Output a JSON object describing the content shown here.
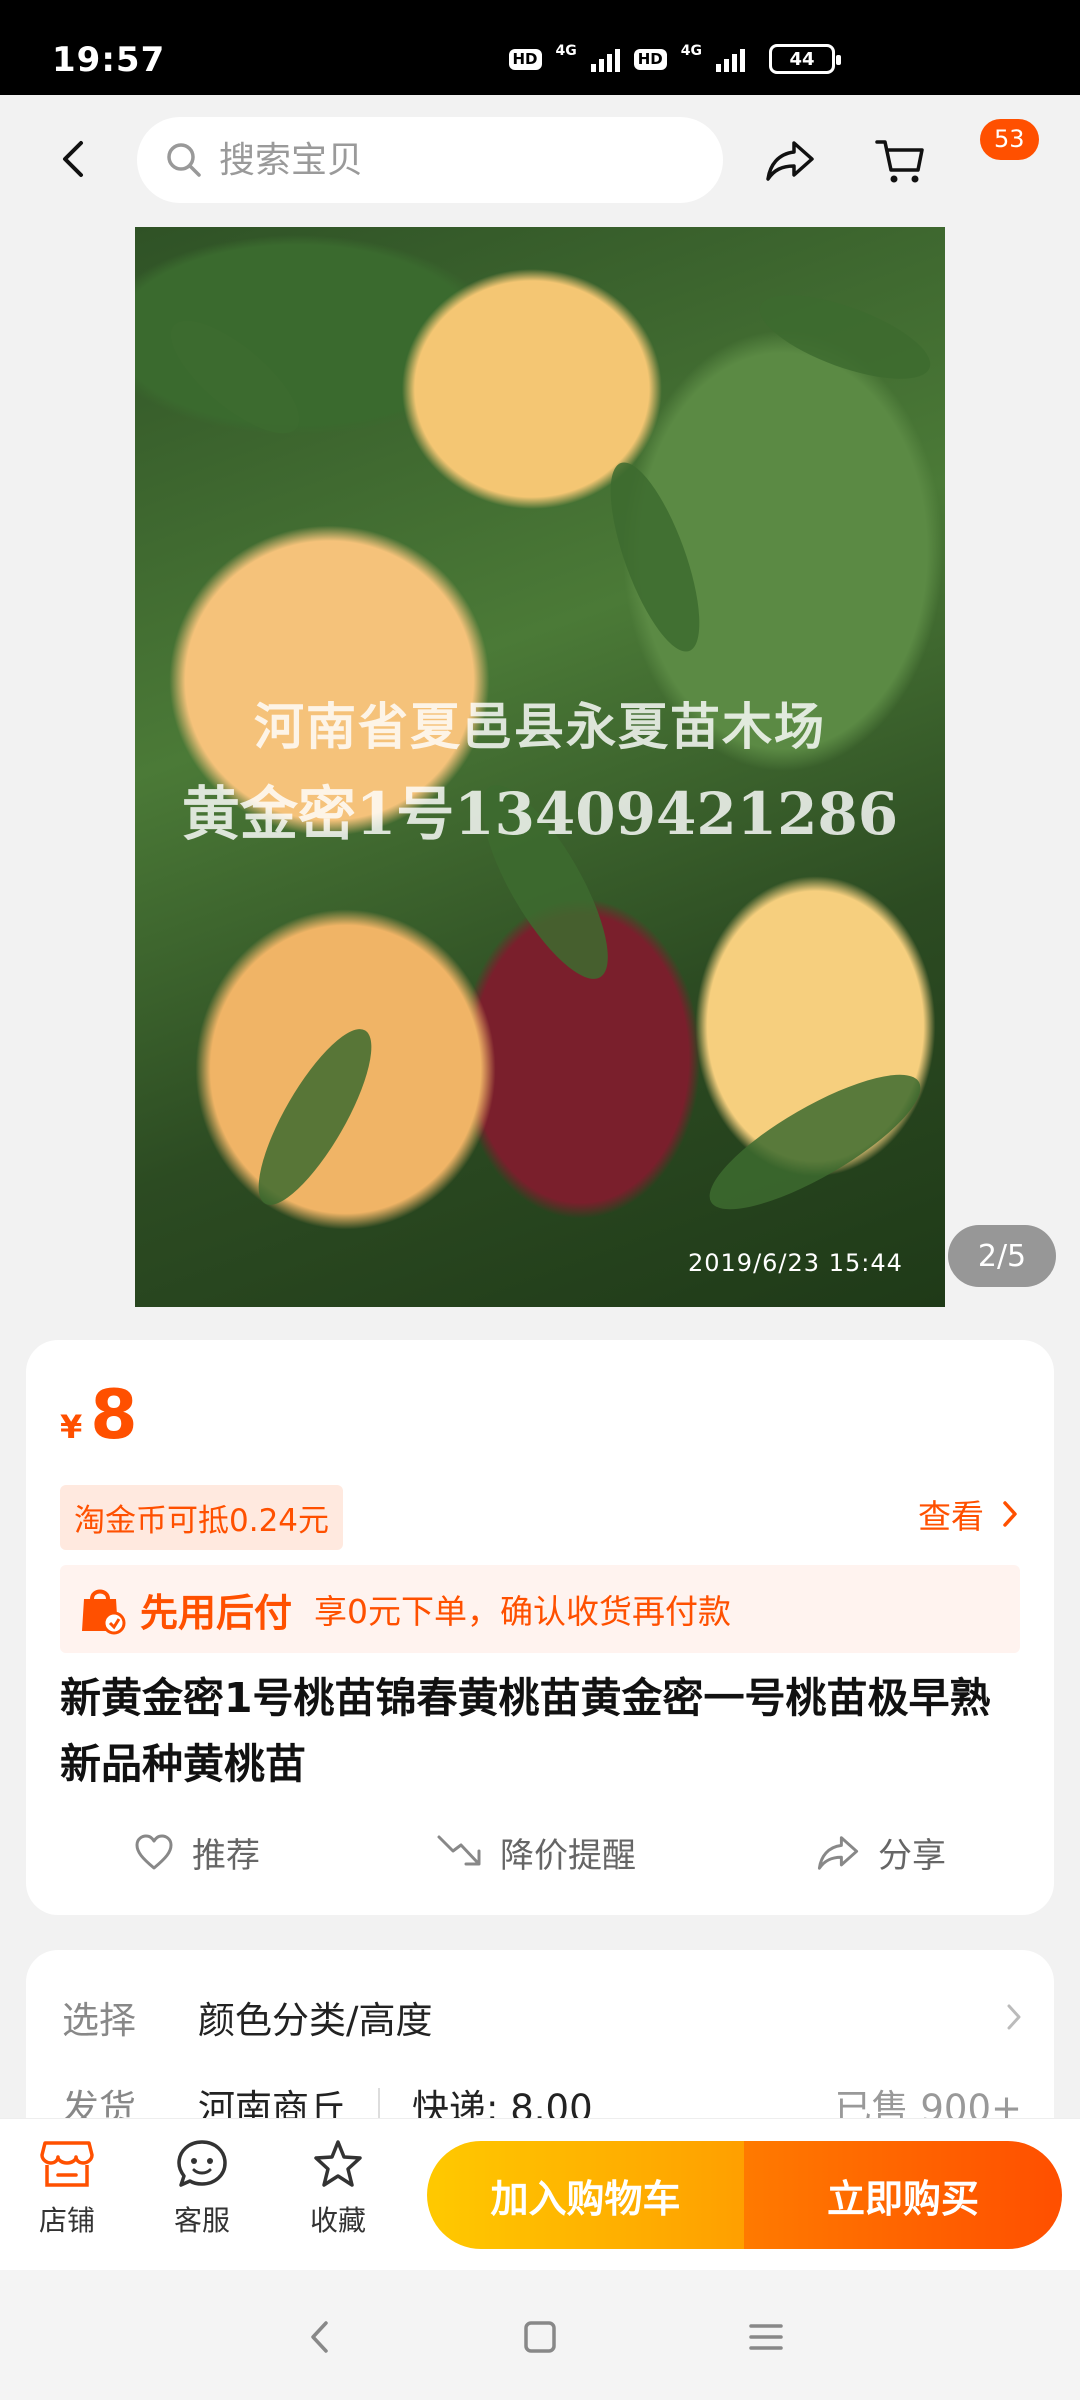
{
  "status_bar": {
    "time": "19:57",
    "hd1": "HD",
    "net1": "4G",
    "hd2": "HD",
    "net2": "4G",
    "battery": "44"
  },
  "top_nav": {
    "search_placeholder": "搜索宝贝",
    "cart_badge": "53",
    "icons": [
      "back-icon",
      "search-icon",
      "share-icon",
      "cart-icon"
    ]
  },
  "gallery": {
    "watermark_line1": "河南省夏邑县永夏苗木场",
    "watermark_line2": "黄金密1号13409421286",
    "photo_date": "2019/6/23  15:44",
    "counter": "2/5"
  },
  "product": {
    "currency": "¥",
    "price": "8",
    "coin_tag": "淘金币可抵0.24元",
    "view_link": "查看",
    "paylater_title": "先用后付",
    "paylater_desc": "享0元下单，确认收货再付款",
    "title": "新黄金密1号桃苗锦春黄桃苗黄金密一号桃苗极早熟新品种黄桃苗",
    "actions": {
      "recommend": "推荐",
      "price_alert": "降价提醒",
      "share": "分享"
    }
  },
  "spec": {
    "select_label": "选择",
    "select_value": "颜色分类/高度",
    "ship_label": "发货",
    "ship_origin": "河南商丘",
    "ship_fee": "快递: 8.00",
    "sold": "已售 900+"
  },
  "bottom_bar": {
    "shop": "店铺",
    "service": "客服",
    "favorite": "收藏",
    "add_cart": "加入购物车",
    "buy_now": "立即购买"
  },
  "colors": {
    "accent": "#ff5000",
    "cart_button": "#ffb400",
    "buy_button": "#ff5a00"
  }
}
